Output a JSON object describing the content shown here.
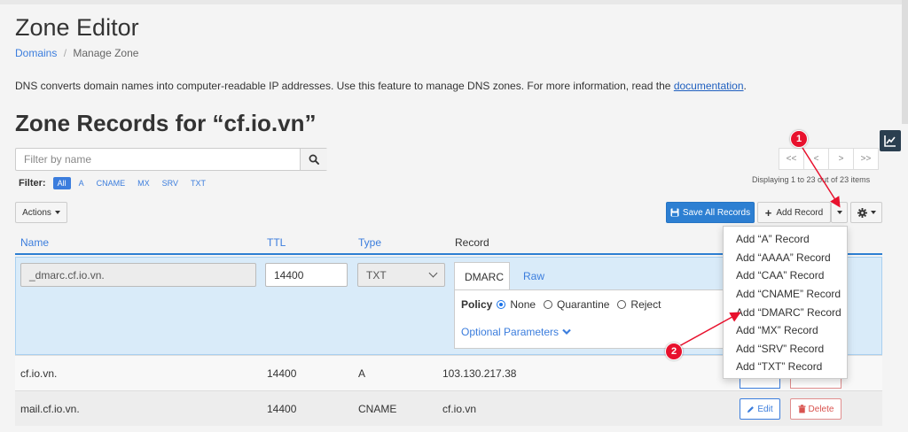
{
  "page": {
    "title": "Zone Editor",
    "breadcrumb": {
      "parent": "Domains",
      "separator": "/",
      "current": "Manage Zone"
    },
    "description": {
      "text": "DNS converts domain names into computer-readable IP addresses. Use this feature to manage DNS zones. For more information, read the ",
      "link": "documentation",
      "suffix": "."
    },
    "zone_heading": "Zone Records for “cf.io.vn”"
  },
  "filter": {
    "placeholder": "Filter by name",
    "label": "Filter:",
    "chips": [
      "All",
      "A",
      "CNAME",
      "MX",
      "SRV",
      "TXT"
    ],
    "active_chip": "All"
  },
  "pagination": {
    "buttons": [
      "<<",
      "<",
      ">",
      ">>"
    ],
    "displaying": "Displaying 1 to 23 out of 23 items"
  },
  "toolbar": {
    "actions_label": "Actions",
    "save_all_label": "Save All Records",
    "add_record_label": "Add Record",
    "plus": "+"
  },
  "add_record_menu": [
    "Add “A” Record",
    "Add “AAAA” Record",
    "Add “CAA” Record",
    "Add “CNAME” Record",
    "Add “DMARC” Record",
    "Add “MX” Record",
    "Add “SRV” Record",
    "Add “TXT” Record"
  ],
  "table": {
    "headers": {
      "name": "Name",
      "ttl": "TTL",
      "type": "Type",
      "record": "Record"
    },
    "edit_row": {
      "name": "_dmarc.cf.io.vn.",
      "ttl": "14400",
      "type": "TXT",
      "tabs": [
        "DMARC",
        "Raw"
      ],
      "active_tab": "DMARC",
      "policy_label": "Policy",
      "policy_options": [
        "None",
        "Quarantine",
        "Reject"
      ],
      "policy_selected": "None",
      "optional_label": "Optional Parameters"
    },
    "rows": [
      {
        "name": "cf.io.vn.",
        "ttl": "14400",
        "type": "A",
        "record": "103.130.217.38"
      },
      {
        "name": "mail.cf.io.vn.",
        "ttl": "14400",
        "type": "CNAME",
        "record": "cf.io.vn",
        "edit_label": "Edit",
        "delete_label": "Delete"
      }
    ]
  },
  "annotations": {
    "badge_1": "1",
    "badge_2": "2"
  },
  "colors": {
    "accent": "#2d7fd2",
    "link": "#3b7ddd",
    "badge": "#e8112d",
    "edit_row_bg": "#d9ebf9",
    "danger": "#d9534f"
  }
}
